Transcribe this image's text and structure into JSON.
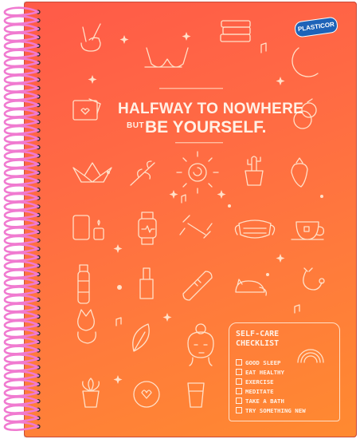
{
  "cover": {
    "brand": "PLASTICOR",
    "headline_line1": "HALFWAY TO NOWHERE",
    "headline_line2_prefix": "BUT",
    "headline_line2_main": "BE YOURSELF.",
    "colors": {
      "gradient_top": "#ff5a48",
      "gradient_bottom": "#ff8a30",
      "line_art": "#ffe0c8",
      "spiral": "#f07ad0",
      "brand_badge": "#1e63b8"
    }
  },
  "checklist": {
    "title": "SELF-CARE CHECKLIST",
    "items": [
      "GOOD SLEEP",
      "EAT HEALTHY",
      "EXERCISE",
      "MEDITATE",
      "TAKE A BATH",
      "TRY SOMETHING NEW"
    ]
  },
  "icons": [
    "peace-hand-icon",
    "books-icon",
    "moon-icon",
    "bra-icon",
    "envelope-heart-icon",
    "peach-icon",
    "paper-crane-icon",
    "leaf-icon",
    "sun-icon",
    "cactus-icon",
    "strawberry-icon",
    "jar-candle-icon",
    "smartwatch-icon",
    "dumbbell-icon",
    "face-mask-icon",
    "tea-cup-icon",
    "water-bottle-icon",
    "nail-polish-icon",
    "bandage-icon",
    "sleeping-cat-icon",
    "stethoscope-icon",
    "corgi-icon",
    "monstera-leaf-icon",
    "woman-face-icon",
    "potted-succulent-icon",
    "heart-plate-icon",
    "glass-icon",
    "rainbow-icon"
  ]
}
